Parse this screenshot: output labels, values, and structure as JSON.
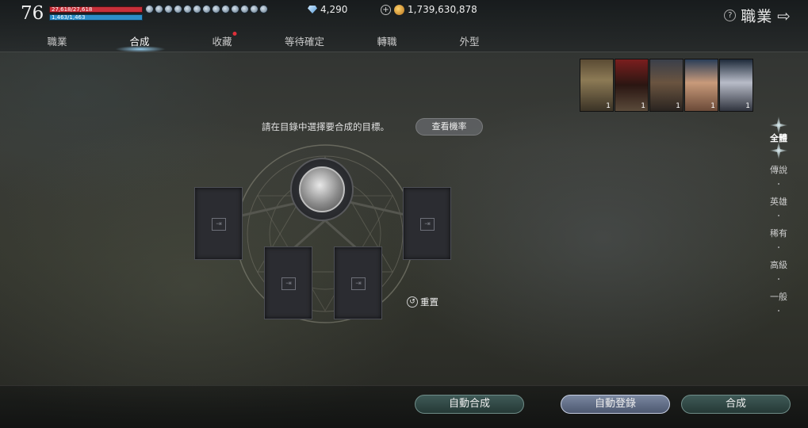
{
  "player": {
    "level": "76",
    "hp_text": "27,618/27,618",
    "mp_text": "1,463/1,463"
  },
  "currency": {
    "gems": "4,290",
    "gold": "1,739,630,878"
  },
  "header": {
    "title": "職業"
  },
  "tabs": [
    {
      "label": "職業"
    },
    {
      "label": "合成"
    },
    {
      "label": "收藏"
    },
    {
      "label": "等待確定"
    },
    {
      "label": "轉職"
    },
    {
      "label": "外型"
    }
  ],
  "active_tab": "合成",
  "portraits": [
    {
      "count": "1"
    },
    {
      "count": "1"
    },
    {
      "count": "1"
    },
    {
      "count": "1"
    },
    {
      "count": "1"
    }
  ],
  "grades": [
    {
      "label": "全體"
    },
    {
      "label": "傳說"
    },
    {
      "label": "英雄"
    },
    {
      "label": "稀有"
    },
    {
      "label": "高級"
    },
    {
      "label": "一般"
    }
  ],
  "active_grade": "全體",
  "main": {
    "instruction": "請在目錄中選擇要合成的目標。",
    "odds_button": "查看機率",
    "reset_label": "重置"
  },
  "actions": {
    "auto_combine": "自動合成",
    "auto_register": "自動登錄",
    "combine": "合成"
  },
  "colors": {
    "hp": "#c8303a",
    "mp": "#2d8ec9",
    "new_badge": "#e0303a",
    "accent_button": "#7a87a0"
  },
  "icons": {
    "gem": "diamond-gem-icon",
    "gold": "gold-coin-icon",
    "add": "plus-circle-icon",
    "help": "question-circle-icon",
    "back": "back-arrow-icon",
    "reset": "reset-circle-icon",
    "slot": "card-slot-icon"
  }
}
